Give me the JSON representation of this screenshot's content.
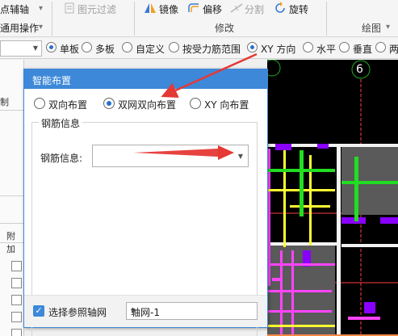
{
  "ribbon": {
    "axis_aux_label": "点辅轴",
    "general_ops_label": "通用操作",
    "filter_label": "图元过滤",
    "mirror_label": "镜像",
    "offset_label": "偏移",
    "split_label": "分割",
    "rotate_label": "旋转",
    "modify_group": "修改",
    "draw_group": "绘图",
    "dropdown_glyph": "▾"
  },
  "toolbar": {
    "options": [
      {
        "label": "单板",
        "selected": true
      },
      {
        "label": "多板",
        "selected": false
      },
      {
        "label": "自定义",
        "selected": false
      },
      {
        "label": "按受力筋范围",
        "selected": false
      },
      {
        "label": "XY 方向",
        "selected": true
      },
      {
        "label": "水平",
        "selected": false
      },
      {
        "label": "垂直",
        "selected": false
      },
      {
        "label": "两",
        "selected": false
      }
    ]
  },
  "left_panel": {
    "col1_label": "制",
    "col2_label": "附加"
  },
  "canvas": {
    "axis_marker": "6",
    "line_colors": {
      "magenta": "#ff44ff",
      "yellow": "#ffff33",
      "green": "#22dd22",
      "purple": "#8a00ff",
      "red": "#ff3030",
      "gray": "#555555"
    }
  },
  "dialog": {
    "title": "智能布置",
    "layout_options": [
      {
        "label": "双向布置",
        "selected": false
      },
      {
        "label": "双网双向布置",
        "selected": true
      },
      {
        "label": "XY 向布置",
        "selected": false
      }
    ],
    "group_title": "钢筋信息",
    "field_label": "钢筋信息:",
    "field_value": "",
    "select_axis_label": "选择参照轴网",
    "select_axis_checked": true,
    "axis_grid_value": "轴网-1"
  },
  "colors": {
    "accent": "#3d88d8",
    "annotation_arrow": "#e53935"
  }
}
